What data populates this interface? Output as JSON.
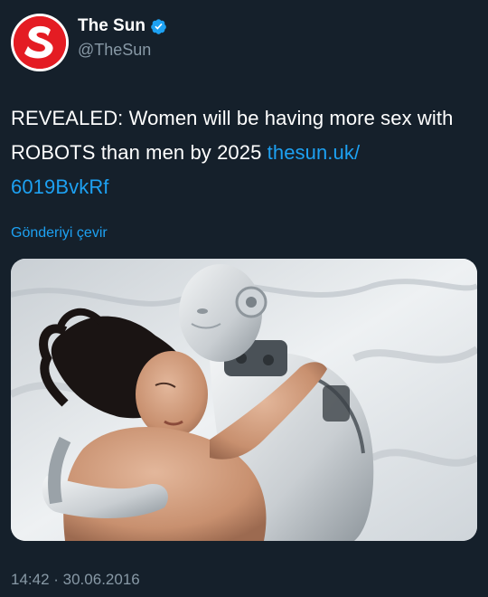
{
  "account": {
    "display_name": "The Sun",
    "handle": "@TheSun",
    "avatar_letter": "S",
    "verified": true,
    "brand_color": "#e41c23"
  },
  "tweet": {
    "text": "REVEALED: Women will be having more sex with ROBOTS than men by 2025 ",
    "link_line1": "thesun.uk/",
    "link_line2": "6019BvkRf",
    "translate_label": "Gönderiyi çevir",
    "timestamp": "14:42 · 30.06.2016"
  },
  "colors": {
    "background": "#15202b",
    "link": "#1da1f2",
    "secondary_text": "#8899a6"
  }
}
